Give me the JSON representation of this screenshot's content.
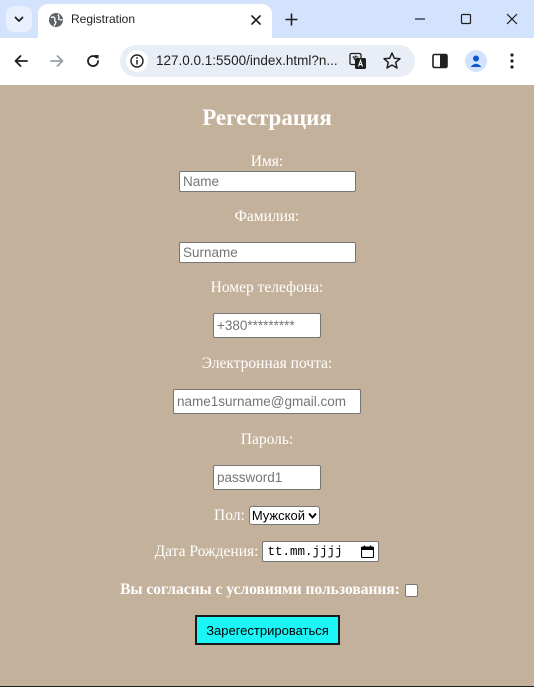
{
  "browser": {
    "tab_title": "Registration",
    "url": "127.0.0.1:5500/index.html?n..."
  },
  "form": {
    "title": "Регестрация",
    "name": {
      "label": "Имя:",
      "placeholder": "Name"
    },
    "surname": {
      "label": "Фамилия:",
      "placeholder": "Surname"
    },
    "phone": {
      "label": "Номер телефона:",
      "placeholder": "+380*********"
    },
    "email": {
      "label": "Электронная почта:",
      "placeholder": "name1surname@gmail.com"
    },
    "password": {
      "label": "Пароль:",
      "placeholder": "password1"
    },
    "gender": {
      "label": "Пол:",
      "selected": "Мужской"
    },
    "birthdate": {
      "label": "Дата Рождения:",
      "value": "tt.mm.jjjj"
    },
    "terms": {
      "label": "Вы согласны с условиями пользования:",
      "checked": false
    },
    "submit_label": "Зарегестрироваться"
  },
  "colors": {
    "page_background": "#c4b19b",
    "submit_background": "#1cf5f6",
    "titlebar": "#d3e3fd"
  }
}
